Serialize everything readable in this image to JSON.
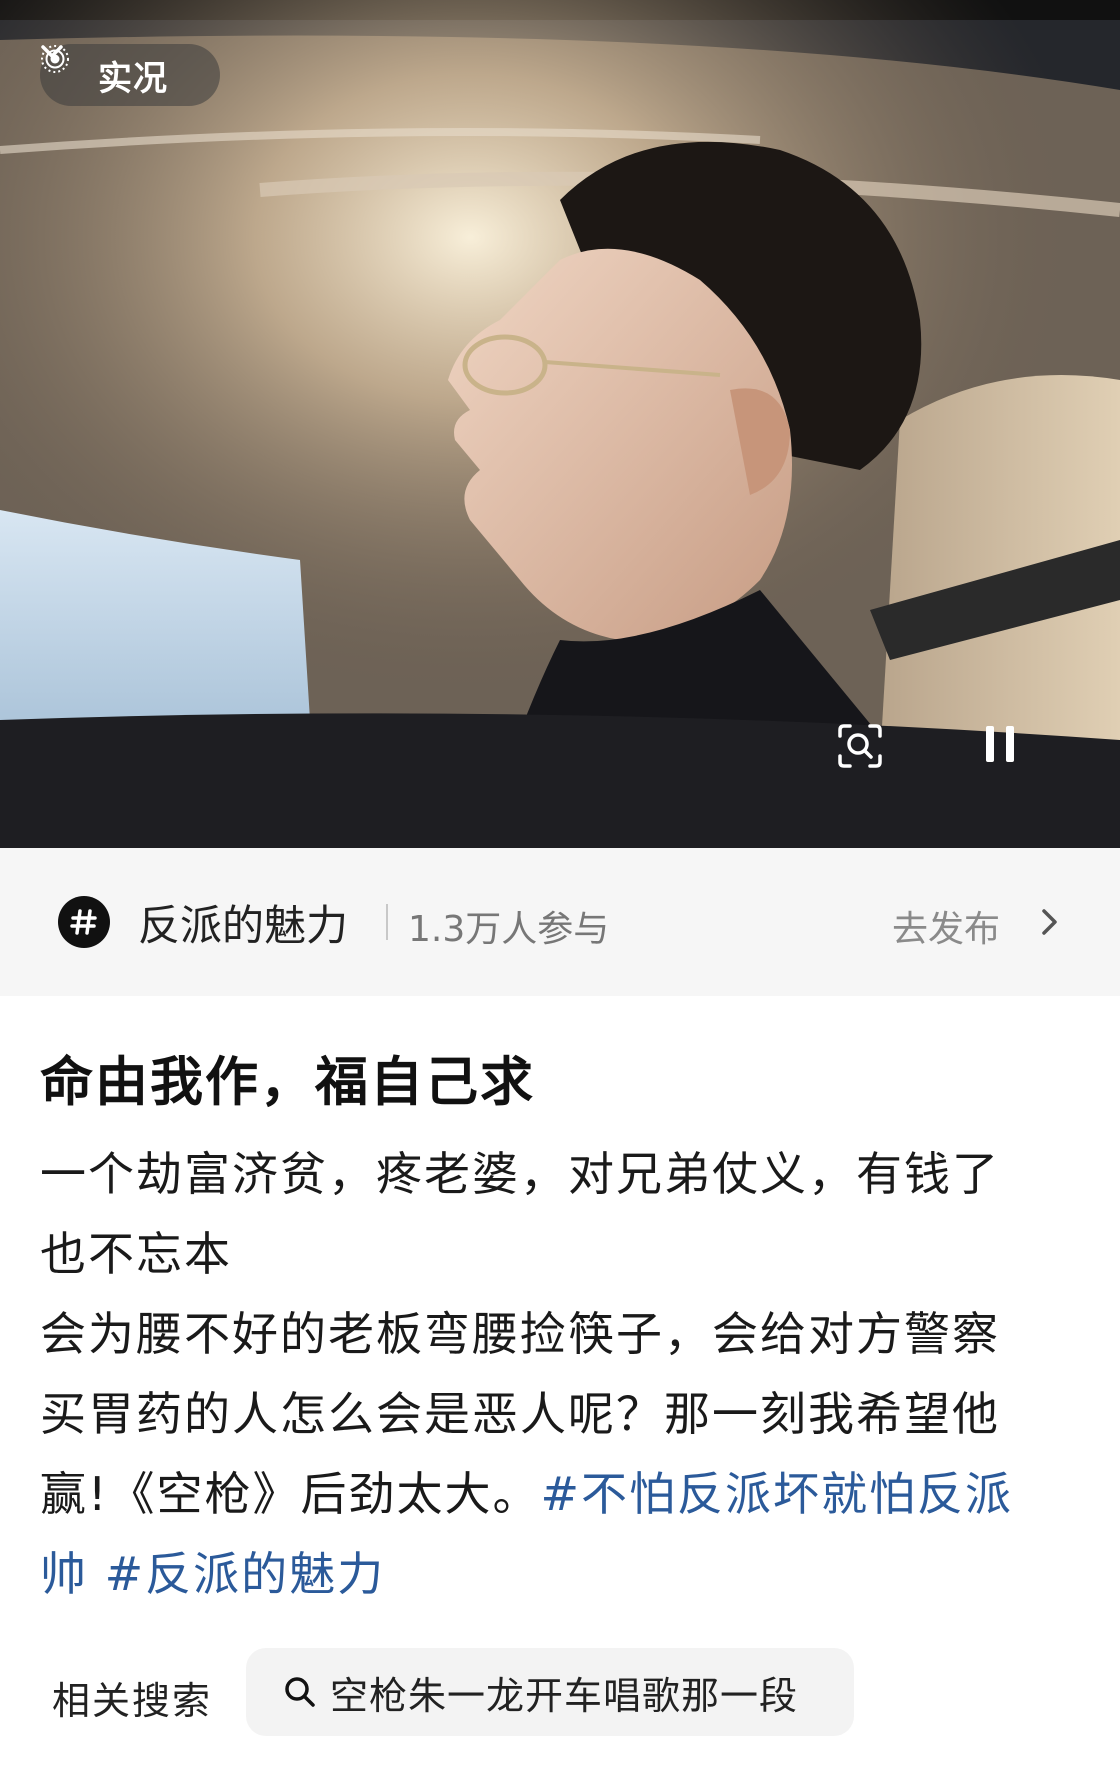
{
  "photo": {
    "live_label": "实况",
    "icons": {
      "live": "live-photo-icon",
      "dropdown": "chevron-down-icon",
      "lens": "image-search-icon",
      "pause": "pause-icon"
    }
  },
  "topic": {
    "icon": "hashtag-icon",
    "name": "反派的魅力",
    "participants": "1.3万人参与",
    "action_label": "去发布",
    "action_icon": "chevron-right-icon"
  },
  "post": {
    "title": "命由我作，福自己求",
    "lines": [
      "一个劫富济贫，疼老婆，对兄弟仗义，有钱了",
      "也不忘本",
      "会为腰不好的老板弯腰捡筷子，会给对方警察",
      "买胃药的人怎么会是恶人呢？那一刻我希望他"
    ],
    "line5_text": "赢!《空枪》后劲太大。",
    "hashtag1_part1": "#不怕反派坏就怕反派",
    "hashtag1_part2": "帅",
    "hashtag2": "#反派的魅力",
    "hashtag_color": "#2b5a9a"
  },
  "related": {
    "label": "相关搜索",
    "query": "空枪朱一龙开车唱歌那一段",
    "icon": "search-icon"
  }
}
